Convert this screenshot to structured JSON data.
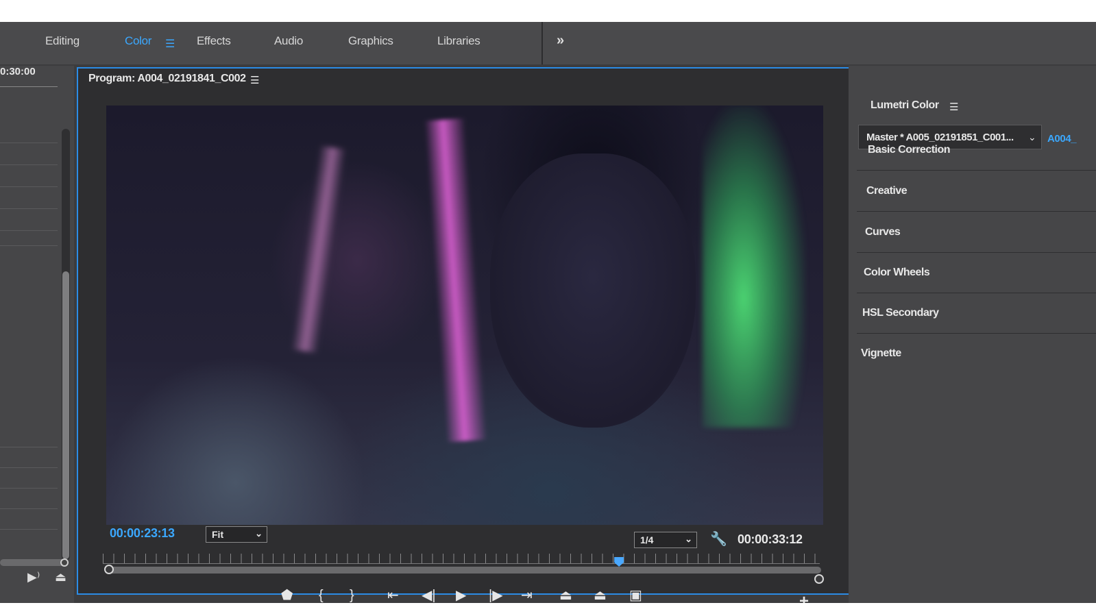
{
  "workspaces": {
    "tabs": [
      {
        "label": "Editing"
      },
      {
        "label": "Color"
      },
      {
        "label": "Effects"
      },
      {
        "label": "Audio"
      },
      {
        "label": "Graphics"
      },
      {
        "label": "Libraries"
      }
    ],
    "active_tab": "Color",
    "overflow_icon": "double-chevron-right-icon"
  },
  "source_panel": {
    "timecode": "0:30:00"
  },
  "program_monitor": {
    "title": "Program: A004_02191841_C002",
    "current_timecode": "00:00:23:13",
    "zoom_select": "Fit",
    "resolution_select": "1/4",
    "duration_timecode": "00:00:33:12",
    "playhead_fraction": 0.72,
    "controls": [
      "add-marker-icon",
      "mark-in-icon",
      "mark-out-icon",
      "go-to-in-icon",
      "step-back-icon",
      "play-icon",
      "step-forward-icon",
      "go-to-out-icon",
      "lift-icon",
      "extract-icon",
      "export-frame-icon",
      "button-editor-plus-icon"
    ]
  },
  "lumetri": {
    "title": "Lumetri Color",
    "master_clip": "Master * A005_02191851_C001...",
    "clip_tab": "A004_",
    "sections": [
      {
        "label": "Basic Correction"
      },
      {
        "label": "Creative"
      },
      {
        "label": "Curves"
      },
      {
        "label": "Color Wheels"
      },
      {
        "label": "HSL Secondary"
      },
      {
        "label": "Vignette"
      }
    ]
  },
  "colors": {
    "accent": "#3ba8ff",
    "panel_border": "#2b8ce6",
    "panel_bg": "#3c3c3e"
  }
}
